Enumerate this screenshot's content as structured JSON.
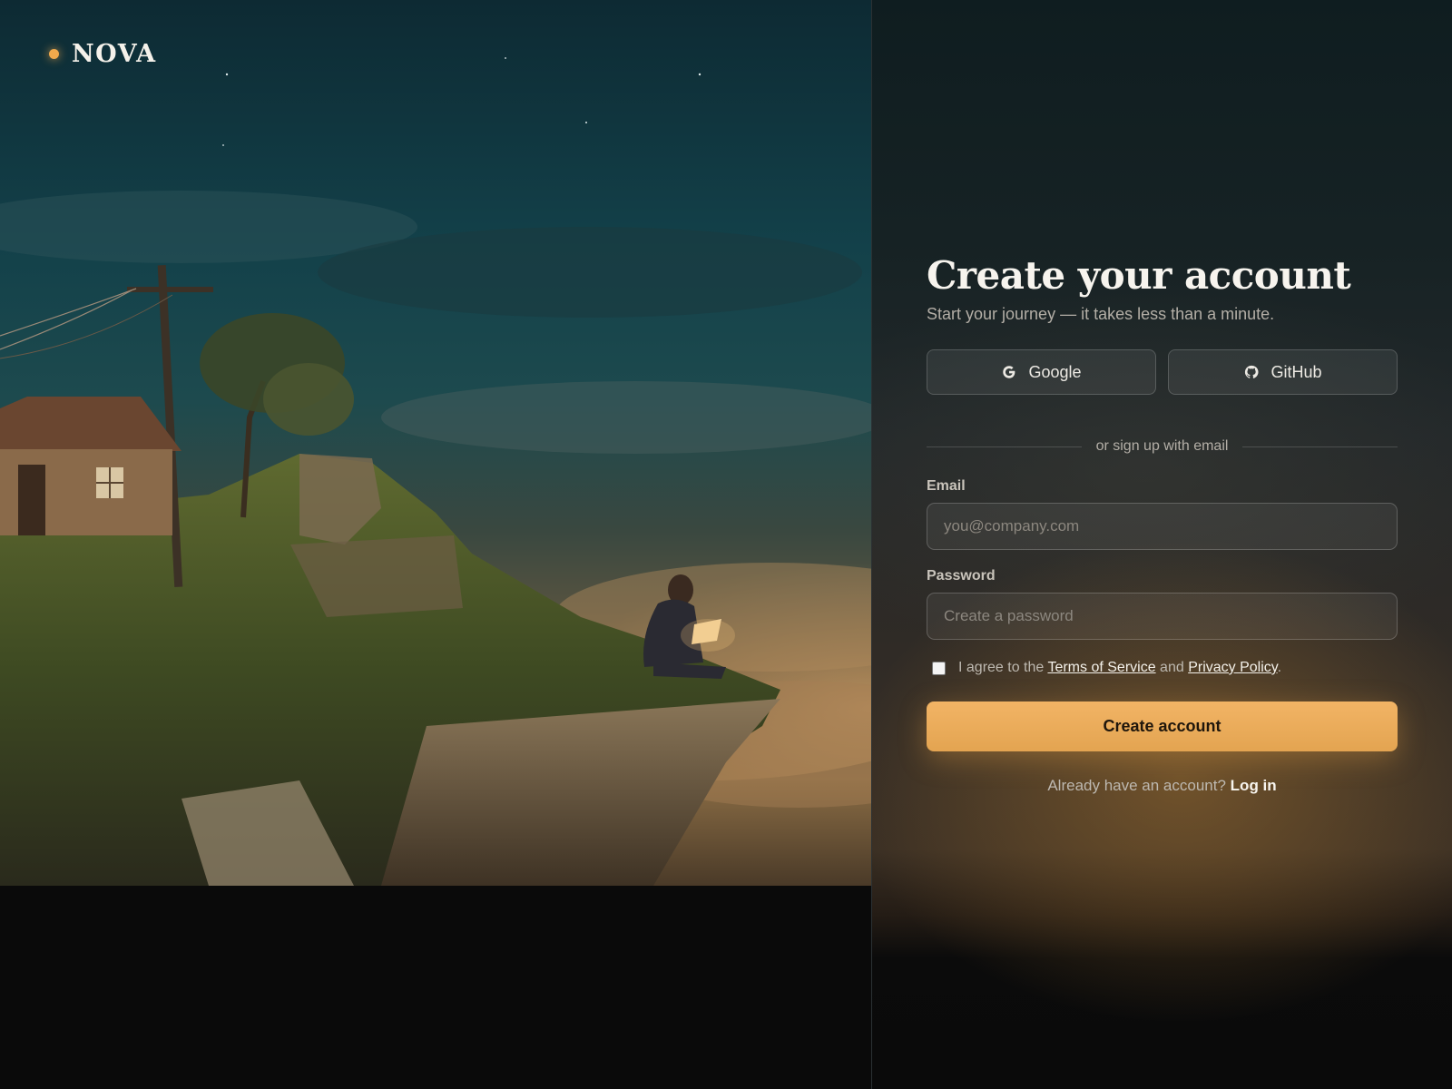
{
  "brand": {
    "name": "NOVA",
    "accent_color": "#f0a94c"
  },
  "hero": {
    "icon": "landscape-cliff-illustration"
  },
  "form": {
    "title": "Create your account",
    "subtitle": "Start your journey — it takes less than a minute.",
    "oauth": [
      {
        "label": "Google",
        "icon": "google-icon"
      },
      {
        "label": "GitHub",
        "icon": "github-icon"
      }
    ],
    "divider_text": "or sign up with email",
    "email": {
      "label": "Email",
      "placeholder": "you@company.com",
      "value": ""
    },
    "password": {
      "label": "Password",
      "placeholder": "Create a password",
      "value": ""
    },
    "agree": {
      "checked": false,
      "prefix": "I agree to the",
      "terms_label": "Terms of Service",
      "and": "and",
      "privacy_label": "Privacy Policy",
      "suffix": "."
    },
    "submit_label": "Create account",
    "login_prompt": "Already have an account?",
    "login_label": "Log in",
    "primary_color": "#eba95a"
  }
}
